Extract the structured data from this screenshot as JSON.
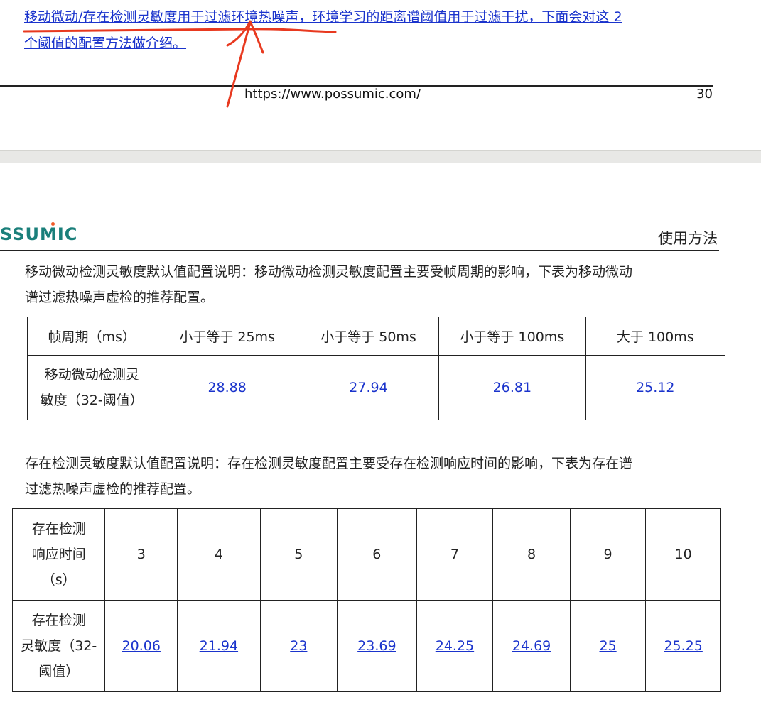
{
  "top_page": {
    "link_text_line1": "移动微动/存在检测灵敏度用于过滤环境热噪声，环境学习的距离谱阈值用于过滤干扰，下面会对这 2",
    "link_text_line2": "个阈值的配置方法做介绍。",
    "footer_url": "https://www.possumic.com/",
    "page_number": "30"
  },
  "bottom_page": {
    "logo_text": "SSUMIC",
    "section_title": "使用方法",
    "para1_line1": "移动微动检测灵敏度默认值配置说明：移动微动检测灵敏度配置主要受帧周期的影响，下表为移动微动",
    "para1_line2": "谱过滤热噪声虚检的推荐配置。",
    "table1": {
      "header": [
        "帧周期（ms）",
        "小于等于 25ms",
        "小于等于 50ms",
        "小于等于 100ms",
        "大于 100ms"
      ],
      "row_label_line1": "移动微动检测灵",
      "row_label_line2": "敏度（32-阈值）",
      "values": [
        "28.88",
        "27.94",
        "26.81",
        "25.12"
      ]
    },
    "para2_line1": "存在检测灵敏度默认值配置说明：存在检测灵敏度配置主要受存在检测响应时间的影响，下表为存在谱",
    "para2_line2": "过滤热噪声虚检的推荐配置。",
    "table2": {
      "header_label_line1": "存在检测",
      "header_label_line2": "响应时间",
      "header_label_line3": "（s）",
      "header": [
        "3",
        "4",
        "5",
        "6",
        "7",
        "8",
        "9",
        "10"
      ],
      "row_label_line1": "存在检测",
      "row_label_line2": "灵敏度（32-",
      "row_label_line3": "阈值）",
      "values": [
        "20.06",
        "21.94",
        "23",
        "23.69",
        "24.25",
        "24.69",
        "25",
        "25.25"
      ]
    }
  },
  "colors": {
    "link": "#1a33cc",
    "annotation": "#e8391f",
    "logo": "#1a7f7a"
  }
}
